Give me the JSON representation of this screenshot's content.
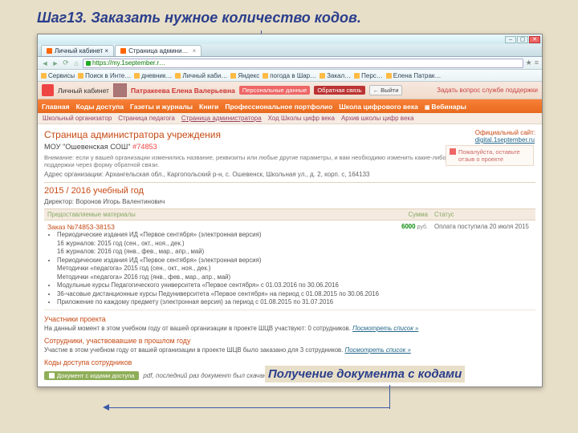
{
  "slide": {
    "title": "Шаг13. Заказать нужное количество кодов.",
    "bottom": "Получение документа с кодами"
  },
  "window": {
    "min": "–",
    "max": "▢",
    "close": "✕"
  },
  "tabs": {
    "t1": "Личный кабинет ×",
    "t2": "Страница админи…"
  },
  "url": "https://my.1september.r…",
  "nav": {
    "back": "◄",
    "fwd": "►",
    "reload": "⟳",
    "home": "⌂",
    "star": "★",
    "menu": "≡"
  },
  "bookmarks": {
    "b0": "Сервисы",
    "b1": "Поиск в Инте…",
    "b2": "дневник…",
    "b3": "Личный каби…",
    "b4": "Яндекс",
    "b5": "погода в Шар…",
    "b6": "Закал…",
    "b7": "Перс…",
    "b8": "Елена Патрак…"
  },
  "userbar": {
    "cabinet": "Личный кабинет",
    "name": "Патракеева Елена Валерьевна",
    "btn1": "Персональные данные",
    "btn2": "Обратная связь",
    "logout": "← Выйти",
    "support": "Задать вопрос службе поддержки"
  },
  "mainnav": {
    "n0": "Главная",
    "n1": "Коды доступа",
    "n2": "Газеты и журналы",
    "n3": "Книги",
    "n4": "Профессиональное портфолио",
    "n5": "Школа цифрового века",
    "n6": "Вебинары"
  },
  "subnav": {
    "s0": "Школьный организатор",
    "s1": "Страница педагога",
    "s2": "Страница администратора",
    "s3": "Ход Школы цифр века",
    "s4": "Архив школы цифр века"
  },
  "content": {
    "title": "Страница администратора учреждения",
    "site_label": "Официальный сайт:",
    "site_link": "digital.1september.ru",
    "org": "МОУ \"Ошевенская СОШ\" ",
    "org_num": "#74853",
    "note": "Внимание: если у вашей организации изменились название, реквизиты или любые другие параметры, и вам необходимо изменить какие-либо данные, обратитесь в Службу поддержки через форму обратной связи.",
    "addr": "Адрес организации: Архангельская обл., Каргопольский р-н, с. Ошевенск, Школьная ул., д. 2, корп. с, 164133",
    "feedback": "Пожалуйста, оставьте отзыв о проекте"
  },
  "year": {
    "title": "2015 / 2016 учебный год",
    "director": "Директор: Воронов Игорь Валентинович",
    "col1": "Предоставляемые материалы",
    "col2": "Сумма",
    "col3": "Статус",
    "order": "Заказ №74853-38153",
    "li0": "Периодические издания ИД «Первое сентября» (электронная версия)",
    "li0a": "16 журналов: 2015 год (сен., окт., ноя., дек.)",
    "li0b": "16 журналов: 2016 год (янв., фев., мар., апр., май)",
    "li1": "Периодические издания ИД «Первое сентября» (электронная версия)",
    "li1a": "Методички «педагога» 2015 год (сен., окт., ноя., дек.)",
    "li1b": "Методички «педагога» 2016 год (янв., фев., мар., апр., май)",
    "li2": "Модульные курсы Педагогического университета «Первое сентября» с 01.03.2016 по 30.06.2016",
    "li3": "36-часовые дистанционные курсы Педуниверситета «Первое сентября» на период с 01.08.2015 по 30.06.2016",
    "li4": "Приложение по каждому предмету (электронная версия) за период с 01.08.2015 по 31.07.2016",
    "price": "6000",
    "rub": "руб.",
    "status": "Оплата поступила 20 июля 2015"
  },
  "sec1": {
    "h": "Участники проекта",
    "p": "На данный момент в этом учебном году от вашей организации в проекте ШЦВ участвуют: 0 сотрудников. ",
    "link": "Посмотреть список »"
  },
  "sec2": {
    "h": "Сотрудники, участвовавшие в прошлом году",
    "p": "Участие в этом учебном году от вашей организации в проекте ШЦВ было заказано для 3 сотрудников. ",
    "link": "Посмотреть список »"
  },
  "sec3": {
    "h": "Коды доступа сотрудников"
  },
  "dl": {
    "badge": "Документ с кодами доступа",
    "text": "pdf, последний раз документ был скачан …"
  }
}
